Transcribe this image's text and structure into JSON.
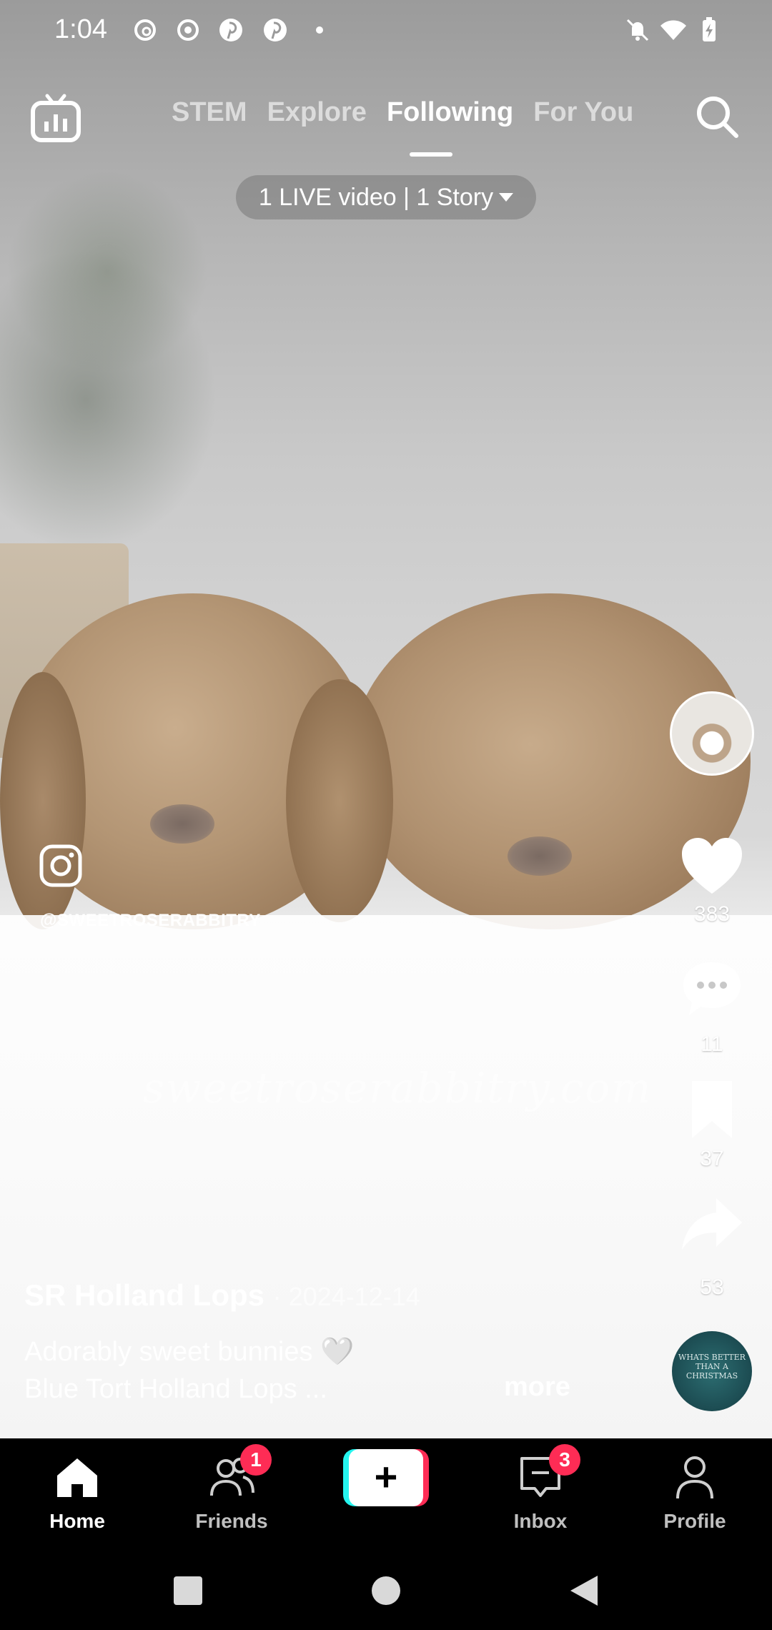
{
  "status_bar": {
    "time": "1:04",
    "left_icons": [
      "threads-icon",
      "record-icon",
      "pinterest-icon",
      "pinterest-icon",
      "dot-icon"
    ],
    "right_icons": [
      "bell-off-icon",
      "wifi-icon",
      "battery-charging-icon"
    ]
  },
  "top_nav": {
    "tabs": [
      {
        "label": "STEM",
        "active": false
      },
      {
        "label": "Explore",
        "active": false
      },
      {
        "label": "Following",
        "active": true
      },
      {
        "label": "For You",
        "active": false
      }
    ],
    "live_pill": "1 LIVE video | 1 Story"
  },
  "video_overlay": {
    "instagram_handle": "@SWEETROSERABBITRY",
    "watermark": "sweetroserabbitry.com"
  },
  "right_rail": {
    "likes": "383",
    "comments": "11",
    "saves": "37",
    "shares": "53",
    "music_disc_text": "WHATS BETTER THAN A CHRISTMAS"
  },
  "caption": {
    "author": "SR Holland Lops",
    "date": "· 2024-12-14",
    "line1": "Adorably sweet bunnies 🤍",
    "line2": "Blue Tort Holland Lops ...",
    "more": "more"
  },
  "bottom_nav": {
    "home": "Home",
    "friends": "Friends",
    "friends_badge": "1",
    "create": "+",
    "inbox": "Inbox",
    "inbox_badge": "3",
    "profile": "Profile"
  },
  "colors": {
    "accent_red": "#fe2c55",
    "accent_cyan": "#25f4ee"
  }
}
